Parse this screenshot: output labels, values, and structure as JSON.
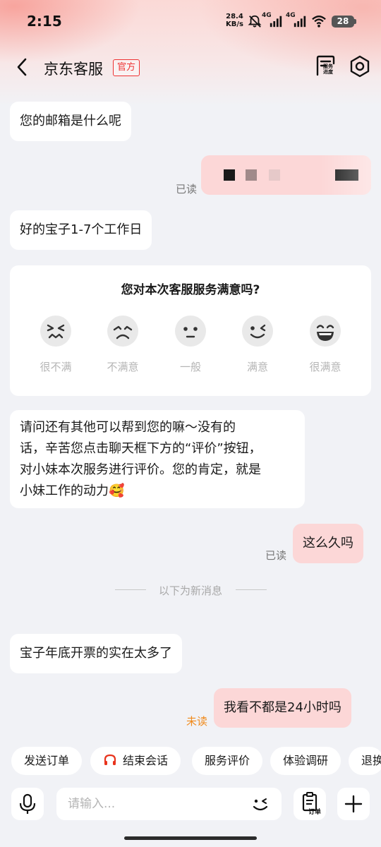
{
  "status_bar": {
    "time": "2:15",
    "net_speed_value": "28.4",
    "net_speed_unit": "KB/s",
    "signal_1_label": "4G",
    "signal_2_label": "4G",
    "battery": "28"
  },
  "header": {
    "title": "京东客服",
    "badge": "官方",
    "progress_label": "服务进度"
  },
  "messages": [
    {
      "side": "agent",
      "text": "您的邮箱是什么呢"
    },
    {
      "side": "user",
      "status": "已读",
      "redacted": true
    },
    {
      "side": "agent",
      "text": "好的宝子1-7个工作日"
    },
    {
      "side": "agent",
      "lines": [
        "请问还有其他可以帮到您的嘛～没有的",
        "话，辛苦您点击聊天框下方的“评价”按钮，",
        "对小妹本次服务进行评价。您的肯定，就是",
        "小妹工作的动力🥰"
      ]
    },
    {
      "side": "user",
      "text": "这么久吗",
      "status": "已读"
    },
    {
      "side": "agent",
      "text": "宝子年底开票的实在太多了"
    },
    {
      "side": "user",
      "text": "我看不都是24小时吗",
      "status": "未读"
    }
  ],
  "survey": {
    "title": "您对本次客服服务满意吗?",
    "options": [
      {
        "label": "很不满",
        "icon": "angry-face-icon"
      },
      {
        "label": "不满意",
        "icon": "sad-face-icon"
      },
      {
        "label": "一般",
        "icon": "neutral-face-icon"
      },
      {
        "label": "满意",
        "icon": "wink-face-icon"
      },
      {
        "label": "很满意",
        "icon": "grin-face-icon"
      }
    ]
  },
  "divider_text": "以下为新消息",
  "quick_actions": [
    {
      "label": "发送订单"
    },
    {
      "label": "结束会话",
      "icon": "headset-icon",
      "icon_color": "#e8331c"
    },
    {
      "label": "服务评价"
    },
    {
      "label": "体验调研"
    },
    {
      "label": "退换"
    }
  ],
  "input": {
    "placeholder": "请输入...",
    "order_label": "订单"
  },
  "colors": {
    "bubble_user": "#fcd7d7",
    "accent_red": "#e33333",
    "unread_orange": "#f08a1c"
  }
}
